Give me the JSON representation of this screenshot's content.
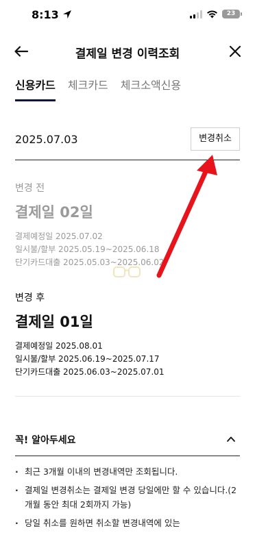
{
  "status": {
    "time": "8:13",
    "battery": "23"
  },
  "nav": {
    "title": "결제일 변경 이력조회"
  },
  "tabs": [
    {
      "label": "신용카드"
    },
    {
      "label": "체크카드"
    },
    {
      "label": "체크소액신용"
    }
  ],
  "record": {
    "date": "2025.07.03",
    "cancel_label": "변경취소"
  },
  "before": {
    "label": "변경 전",
    "title": "결제일 02일",
    "lines": [
      "결제예정일 2025.07.02",
      "일시불/할부 2025.05.19~2025.06.18",
      "단기카드대출 2025.05.03~2025.06.02"
    ]
  },
  "after": {
    "label": "변경 후",
    "title": "결제일 01일",
    "lines": [
      "결제예정일 2025.08.01",
      "일시불/할부 2025.06.19~2025.07.17",
      "단기카드대출 2025.06.03~2025.07.01"
    ]
  },
  "notice": {
    "title": "꼭! 알아두세요",
    "items": [
      "최근 3개월 이내의 변경내역만 조회됩니다.",
      "결제일 변경취소는 결제일 변경 당일에만 할 수 있습니다.(2개월 동안 최대 2회까지 가능)",
      "당일 취소를 원하면 취소할 변경내역에 있는"
    ]
  },
  "colors": {
    "accent_underline": "#0d1240",
    "annotation_arrow": "#e8141c",
    "muted_text": "#9a9a9a"
  },
  "icons": [
    "location-arrow-icon",
    "signal-icon",
    "wifi-icon",
    "battery-icon",
    "back-arrow-icon",
    "close-icon",
    "chevron-up-icon"
  ]
}
